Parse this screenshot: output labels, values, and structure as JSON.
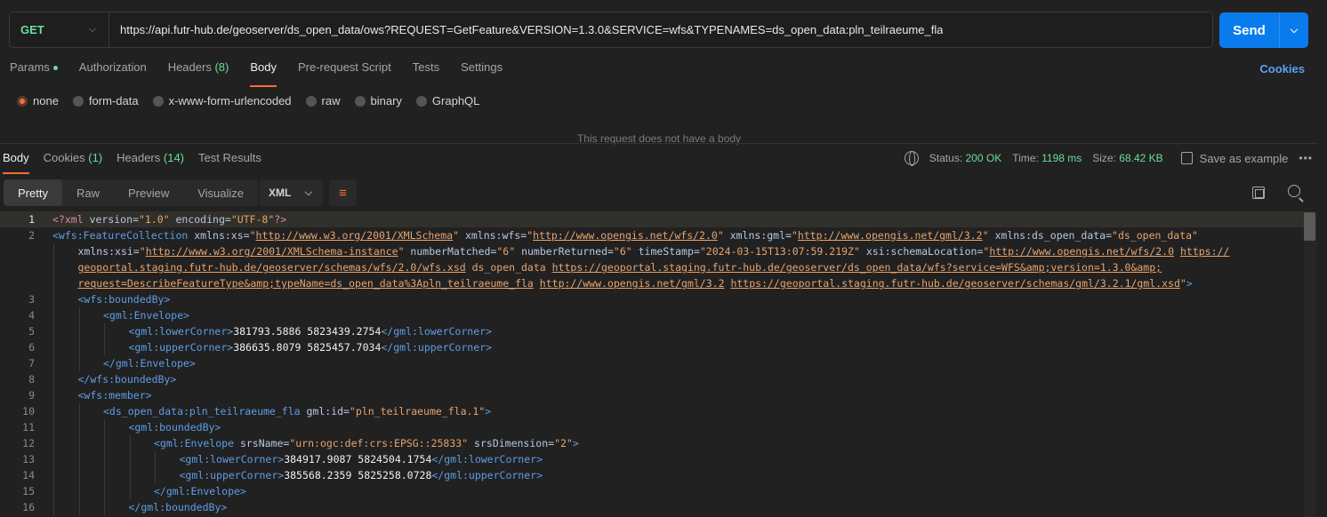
{
  "request": {
    "method": "GET",
    "url": "https://api.futr-hub.de/geoserver/ds_open_data/ows?REQUEST=GetFeature&VERSION=1.3.0&SERVICE=wfs&TYPENAMES=ds_open_data:pln_teilraeume_fla",
    "send_label": "Send"
  },
  "req_tabs": {
    "params": "Params",
    "authorization": "Authorization",
    "headers": "Headers",
    "headers_count": "(8)",
    "body": "Body",
    "prerequest": "Pre-request Script",
    "tests": "Tests",
    "settings": "Settings",
    "cookies": "Cookies"
  },
  "body_types": [
    "none",
    "form-data",
    "x-www-form-urlencoded",
    "raw",
    "binary",
    "GraphQL"
  ],
  "no_body_text": "This request does not have a body",
  "response": {
    "tabs": {
      "body": "Body",
      "cookies": "Cookies",
      "cookies_count": "(1)",
      "headers": "Headers",
      "headers_count": "(14)",
      "test_results": "Test Results"
    },
    "status_label": "Status:",
    "status_value": "200 OK",
    "time_label": "Time:",
    "time_value": "1198 ms",
    "size_label": "Size:",
    "size_value": "68.42 KB",
    "save_example": "Save as example",
    "view_modes": [
      "Pretty",
      "Raw",
      "Preview",
      "Visualize"
    ],
    "format": "XML"
  },
  "code_lines": [
    {
      "n": "1",
      "indent": 0,
      "parts": [
        [
          "pi",
          "<?xml "
        ],
        [
          "attr",
          "version="
        ],
        [
          "val",
          "\"1.0\""
        ],
        [
          "attr",
          " encoding="
        ],
        [
          "val",
          "\"UTF-8\""
        ],
        [
          "pi",
          "?>"
        ]
      ]
    },
    {
      "n": "2",
      "indent": 0,
      "parts": [
        [
          "tag",
          "<wfs:FeatureCollection"
        ],
        [
          "attr",
          " xmlns:xs="
        ],
        [
          "val",
          "\""
        ],
        [
          "link",
          "http://www.w3.org/2001/XMLSchema"
        ],
        [
          "val",
          "\""
        ],
        [
          "attr",
          " xmlns:wfs="
        ],
        [
          "val",
          "\""
        ],
        [
          "link",
          "http://www.opengis.net/wfs/2.0"
        ],
        [
          "val",
          "\""
        ],
        [
          "attr",
          " xmlns:gml="
        ],
        [
          "val",
          "\""
        ],
        [
          "link",
          "http://www.opengis.net/gml/3.2"
        ],
        [
          "val",
          "\""
        ],
        [
          "attr",
          " xmlns:ds_open_data="
        ],
        [
          "val",
          "\"ds_open_data\""
        ]
      ]
    },
    {
      "n": "",
      "indent": 1,
      "parts": [
        [
          "attr",
          "xmlns:xsi="
        ],
        [
          "val",
          "\""
        ],
        [
          "link",
          "http://www.w3.org/2001/XMLSchema-instance"
        ],
        [
          "val",
          "\""
        ],
        [
          "attr",
          " numberMatched="
        ],
        [
          "val",
          "\"6\""
        ],
        [
          "attr",
          " numberReturned="
        ],
        [
          "val",
          "\"6\""
        ],
        [
          "attr",
          " timeStamp="
        ],
        [
          "val",
          "\"2024-03-15T13:07:59.219Z\""
        ],
        [
          "attr",
          " xsi:schemaLocation="
        ],
        [
          "val",
          "\""
        ],
        [
          "link",
          "http://www.opengis.net/wfs/2.0"
        ],
        [
          "val",
          " "
        ],
        [
          "link",
          "https://"
        ]
      ]
    },
    {
      "n": "",
      "indent": 1,
      "parts": [
        [
          "link",
          "geoportal.staging.futr-hub.de/geoserver/schemas/wfs/2.0/wfs.xsd"
        ],
        [
          "val",
          " ds_open_data "
        ],
        [
          "link",
          "https://geoportal.staging.futr-hub.de/geoserver/ds_open_data/wfs?service=WFS&amp;version=1.3.0&amp;"
        ]
      ]
    },
    {
      "n": "",
      "indent": 1,
      "parts": [
        [
          "link",
          "request=DescribeFeatureType&amp;typeName=ds_open_data%3Apln_teilraeume_fla"
        ],
        [
          "val",
          " "
        ],
        [
          "link",
          "http://www.opengis.net/gml/3.2"
        ],
        [
          "val",
          " "
        ],
        [
          "link",
          "https://geoportal.staging.futr-hub.de/geoserver/schemas/gml/3.2.1/gml.xsd"
        ],
        [
          "val",
          "\""
        ],
        [
          "tag",
          ">"
        ]
      ]
    },
    {
      "n": "3",
      "indent": 1,
      "parts": [
        [
          "tag",
          "<wfs:boundedBy>"
        ]
      ]
    },
    {
      "n": "4",
      "indent": 2,
      "parts": [
        [
          "tag",
          "<gml:Envelope>"
        ]
      ]
    },
    {
      "n": "5",
      "indent": 3,
      "parts": [
        [
          "tag",
          "<gml:lowerCorner>"
        ],
        [
          "plain",
          "381793.5886 5823439.2754"
        ],
        [
          "tag",
          "</gml:lowerCorner>"
        ]
      ]
    },
    {
      "n": "6",
      "indent": 3,
      "parts": [
        [
          "tag",
          "<gml:upperCorner>"
        ],
        [
          "plain",
          "386635.8079 5825457.7034"
        ],
        [
          "tag",
          "</gml:upperCorner>"
        ]
      ]
    },
    {
      "n": "7",
      "indent": 2,
      "parts": [
        [
          "tag",
          "</gml:Envelope>"
        ]
      ]
    },
    {
      "n": "8",
      "indent": 1,
      "parts": [
        [
          "tag",
          "</wfs:boundedBy>"
        ]
      ]
    },
    {
      "n": "9",
      "indent": 1,
      "parts": [
        [
          "tag",
          "<wfs:member>"
        ]
      ]
    },
    {
      "n": "10",
      "indent": 2,
      "parts": [
        [
          "tag",
          "<ds_open_data:pln_teilraeume_fla"
        ],
        [
          "attr",
          " gml:id="
        ],
        [
          "val",
          "\"pln_teilraeume_fla.1\""
        ],
        [
          "tag",
          ">"
        ]
      ]
    },
    {
      "n": "11",
      "indent": 3,
      "parts": [
        [
          "tag",
          "<gml:boundedBy>"
        ]
      ]
    },
    {
      "n": "12",
      "indent": 4,
      "parts": [
        [
          "tag",
          "<gml:Envelope"
        ],
        [
          "attr",
          " srsName="
        ],
        [
          "val",
          "\"urn:ogc:def:crs:EPSG::25833\""
        ],
        [
          "attr",
          " srsDimension="
        ],
        [
          "val",
          "\"2\""
        ],
        [
          "tag",
          ">"
        ]
      ]
    },
    {
      "n": "13",
      "indent": 5,
      "parts": [
        [
          "tag",
          "<gml:lowerCorner>"
        ],
        [
          "plain",
          "384917.9087 5824504.1754"
        ],
        [
          "tag",
          "</gml:lowerCorner>"
        ]
      ]
    },
    {
      "n": "14",
      "indent": 5,
      "parts": [
        [
          "tag",
          "<gml:upperCorner>"
        ],
        [
          "plain",
          "385568.2359 5825258.0728"
        ],
        [
          "tag",
          "</gml:upperCorner>"
        ]
      ]
    },
    {
      "n": "15",
      "indent": 4,
      "parts": [
        [
          "tag",
          "</gml:Envelope>"
        ]
      ]
    },
    {
      "n": "16",
      "indent": 3,
      "parts": [
        [
          "tag",
          "</gml:boundedBy>"
        ]
      ]
    }
  ]
}
